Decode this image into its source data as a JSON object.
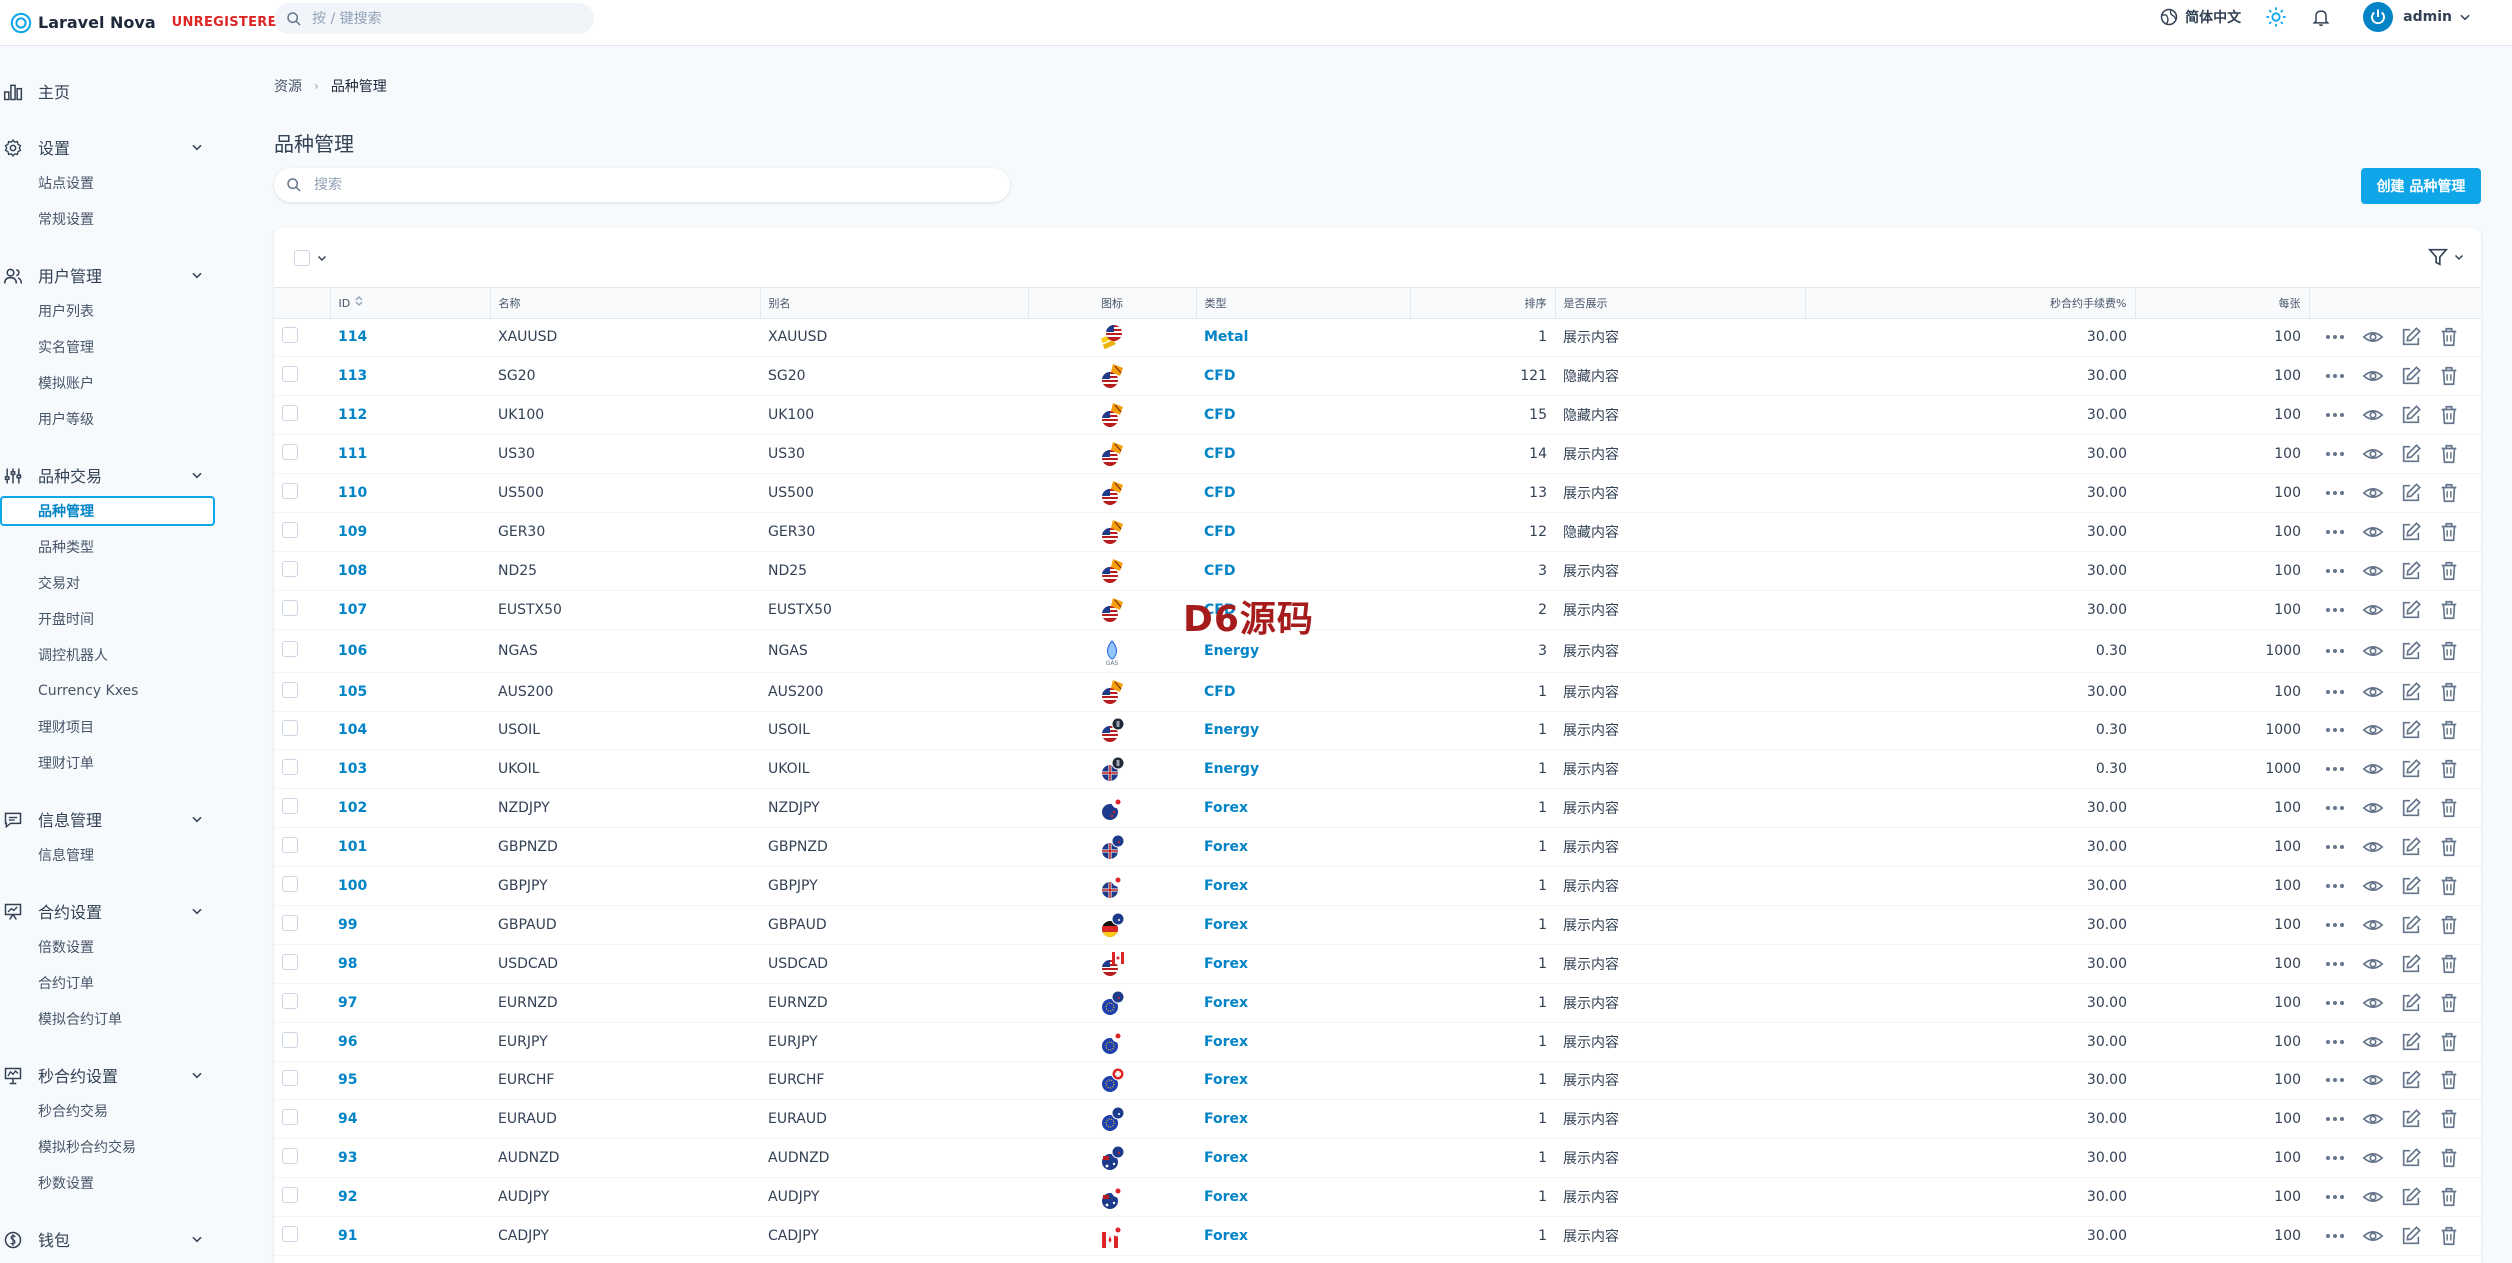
{
  "header": {
    "brand": "Laravel Nova",
    "badge": "UNREGISTERED",
    "search_placeholder": "按 / 键搜索",
    "language": "简体中文",
    "user": "admin"
  },
  "sidebar": {
    "home": "主页",
    "groups": [
      {
        "label": "设置",
        "icon": "gear-icon",
        "items": [
          "站点设置",
          "常规设置"
        ]
      },
      {
        "label": "用户管理",
        "icon": "users-icon",
        "items": [
          "用户列表",
          "实名管理",
          "模拟账户",
          "用户等级"
        ]
      },
      {
        "label": "品种交易",
        "icon": "sliders-icon",
        "items": [
          "品种管理",
          "品种类型",
          "交易对",
          "开盘时间",
          "调控机器人",
          "Currency Kxes",
          "理财项目",
          "理财订单"
        ]
      },
      {
        "label": "信息管理",
        "icon": "message-icon",
        "items": [
          "信息管理"
        ]
      },
      {
        "label": "合约设置",
        "icon": "presentation-icon",
        "items": [
          "倍数设置",
          "合约订单",
          "模拟合约订单"
        ]
      },
      {
        "label": "秒合约设置",
        "icon": "chart-board-icon",
        "items": [
          "秒合约交易",
          "模拟秒合约交易",
          "秒数设置"
        ]
      },
      {
        "label": "钱包",
        "icon": "currency-icon",
        "items": []
      }
    ],
    "active_item": "品种管理"
  },
  "breadcrumb": {
    "root": "资源",
    "current": "品种管理"
  },
  "page_title": "品种管理",
  "resource_search_placeholder": "搜索",
  "create_button": "创建 品种管理",
  "table": {
    "columns": [
      "ID",
      "名称",
      "别名",
      "图标",
      "类型",
      "排序",
      "是否展示",
      "秒合约手续费%",
      "每张"
    ],
    "rows": [
      {
        "id": "114",
        "name": "XAUUSD",
        "alias": "XAUUSD",
        "icon": "gold-us-flag-icon",
        "type": "Metal",
        "sort": "1",
        "show": "展示内容",
        "fee": "30.00",
        "per": "100"
      },
      {
        "id": "113",
        "name": "SG20",
        "alias": "SG20",
        "icon": "cfd-us-flag-icon",
        "type": "CFD",
        "sort": "121",
        "show": "隐藏内容",
        "fee": "30.00",
        "per": "100"
      },
      {
        "id": "112",
        "name": "UK100",
        "alias": "UK100",
        "icon": "cfd-us-flag-icon",
        "type": "CFD",
        "sort": "15",
        "show": "隐藏内容",
        "fee": "30.00",
        "per": "100"
      },
      {
        "id": "111",
        "name": "US30",
        "alias": "US30",
        "icon": "cfd-us-flag-icon",
        "type": "CFD",
        "sort": "14",
        "show": "展示内容",
        "fee": "30.00",
        "per": "100"
      },
      {
        "id": "110",
        "name": "US500",
        "alias": "US500",
        "icon": "cfd-us-flag-icon",
        "type": "CFD",
        "sort": "13",
        "show": "展示内容",
        "fee": "30.00",
        "per": "100"
      },
      {
        "id": "109",
        "name": "GER30",
        "alias": "GER30",
        "icon": "cfd-us-flag-icon",
        "type": "CFD",
        "sort": "12",
        "show": "隐藏内容",
        "fee": "30.00",
        "per": "100"
      },
      {
        "id": "108",
        "name": "ND25",
        "alias": "ND25",
        "icon": "cfd-us-flag-icon",
        "type": "CFD",
        "sort": "3",
        "show": "展示内容",
        "fee": "30.00",
        "per": "100"
      },
      {
        "id": "107",
        "name": "EUSTX50",
        "alias": "EUSTX50",
        "icon": "cfd-us-flag-icon",
        "type": "CFD",
        "sort": "2",
        "show": "展示内容",
        "fee": "30.00",
        "per": "100"
      },
      {
        "id": "106",
        "name": "NGAS",
        "alias": "NGAS",
        "icon": "gas-flame-icon",
        "type": "Energy",
        "sort": "3",
        "show": "展示内容",
        "fee": "0.30",
        "per": "1000"
      },
      {
        "id": "105",
        "name": "AUS200",
        "alias": "AUS200",
        "icon": "cfd-us-flag-icon",
        "type": "CFD",
        "sort": "1",
        "show": "展示内容",
        "fee": "30.00",
        "per": "100"
      },
      {
        "id": "104",
        "name": "USOIL",
        "alias": "USOIL",
        "icon": "oil-us-flag-icon",
        "type": "Energy",
        "sort": "1",
        "show": "展示内容",
        "fee": "0.30",
        "per": "1000"
      },
      {
        "id": "103",
        "name": "UKOIL",
        "alias": "UKOIL",
        "icon": "oil-uk-flag-icon",
        "type": "Energy",
        "sort": "1",
        "show": "展示内容",
        "fee": "0.30",
        "per": "1000"
      },
      {
        "id": "102",
        "name": "NZDJPY",
        "alias": "NZDJPY",
        "icon": "nz-jp-flag-icon",
        "type": "Forex",
        "sort": "1",
        "show": "展示内容",
        "fee": "30.00",
        "per": "100"
      },
      {
        "id": "101",
        "name": "GBPNZD",
        "alias": "GBPNZD",
        "icon": "uk-nz-flag-icon",
        "type": "Forex",
        "sort": "1",
        "show": "展示内容",
        "fee": "30.00",
        "per": "100"
      },
      {
        "id": "100",
        "name": "GBPJPY",
        "alias": "GBPJPY",
        "icon": "uk-jp-flag-icon",
        "type": "Forex",
        "sort": "1",
        "show": "展示内容",
        "fee": "30.00",
        "per": "100"
      },
      {
        "id": "99",
        "name": "GBPAUD",
        "alias": "GBPAUD",
        "icon": "de-au-flag-icon",
        "type": "Forex",
        "sort": "1",
        "show": "展示内容",
        "fee": "30.00",
        "per": "100"
      },
      {
        "id": "98",
        "name": "USDCAD",
        "alias": "USDCAD",
        "icon": "us-ca-flag-icon",
        "type": "Forex",
        "sort": "1",
        "show": "展示内容",
        "fee": "30.00",
        "per": "100"
      },
      {
        "id": "97",
        "name": "EURNZD",
        "alias": "EURNZD",
        "icon": "eu-nz-flag-icon",
        "type": "Forex",
        "sort": "1",
        "show": "展示内容",
        "fee": "30.00",
        "per": "100"
      },
      {
        "id": "96",
        "name": "EURJPY",
        "alias": "EURJPY",
        "icon": "eu-jp-flag-icon",
        "type": "Forex",
        "sort": "1",
        "show": "展示内容",
        "fee": "30.00",
        "per": "100"
      },
      {
        "id": "95",
        "name": "EURCHF",
        "alias": "EURCHF",
        "icon": "eu-ch-flag-icon",
        "type": "Forex",
        "sort": "1",
        "show": "展示内容",
        "fee": "30.00",
        "per": "100"
      },
      {
        "id": "94",
        "name": "EURAUD",
        "alias": "EURAUD",
        "icon": "eu-au-flag-icon",
        "type": "Forex",
        "sort": "1",
        "show": "展示内容",
        "fee": "30.00",
        "per": "100"
      },
      {
        "id": "93",
        "name": "AUDNZD",
        "alias": "AUDNZD",
        "icon": "au-nz-flag-icon",
        "type": "Forex",
        "sort": "1",
        "show": "展示内容",
        "fee": "30.00",
        "per": "100"
      },
      {
        "id": "92",
        "name": "AUDJPY",
        "alias": "AUDJPY",
        "icon": "au-jp-flag-icon",
        "type": "Forex",
        "sort": "1",
        "show": "展示内容",
        "fee": "30.00",
        "per": "100"
      },
      {
        "id": "91",
        "name": "CADJPY",
        "alias": "CADJPY",
        "icon": "ca-jp-flag-icon",
        "type": "Forex",
        "sort": "1",
        "show": "展示内容",
        "fee": "30.00",
        "per": "100"
      }
    ]
  },
  "watermark": "D6源码",
  "colors": {
    "accent": "#0ea5e9",
    "link": "#0284c7",
    "badge": "#dc2626",
    "watermark": "#a61c1c"
  }
}
